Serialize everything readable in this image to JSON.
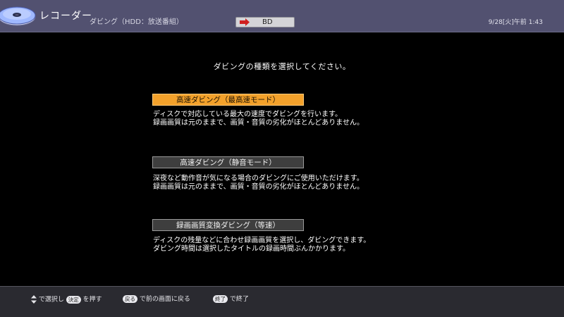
{
  "header": {
    "app_title": "レコーダー",
    "mode_label": "ダビング（HDD：放送番組）",
    "destination": "BD",
    "clock": "9/28[火]午前 1:43"
  },
  "main": {
    "prompt": "ダビングの種類を選択してください。",
    "options": [
      {
        "label": "高速ダビング（最高速モード）",
        "selected": true,
        "desc_line1": "ディスクで対応している最大の速度でダビングを行います。",
        "desc_line2": "録画画質は元のままで、画質・音質の劣化がほとんどありません。"
      },
      {
        "label": "高速ダビング（静音モード）",
        "selected": false,
        "desc_line1": "深夜など動作音が気になる場合のダビングにご使用いただけます。",
        "desc_line2": "録画画質は元のままで、画質・音質の劣化がほとんどありません。"
      },
      {
        "label": "録画画質変換ダビング（等速）",
        "selected": false,
        "desc_line1": "ディスクの残量などに合わせ録画画質を選択し、ダビングできます。",
        "desc_line2": "ダビング時間は選択したタイトルの録画時間ぶんかかります。"
      }
    ]
  },
  "footer": {
    "hint1_text_a": "で選択し",
    "hint1_key": "決定",
    "hint1_text_b": "を押す",
    "hint2_key": "戻る",
    "hint2_text": "で前の画面に戻る",
    "hint3_key": "終了",
    "hint3_text": "で終了"
  },
  "colors": {
    "header_bg": "#525170",
    "selected_bg": "#f3a12b",
    "button_bg": "#3e3e3e",
    "footer_bg": "#2a2a30"
  },
  "icons": {
    "app_icon": "disc-icon",
    "dest_icon": "arrow-right-icon",
    "nav_icon": "up-down-arrows-icon"
  }
}
